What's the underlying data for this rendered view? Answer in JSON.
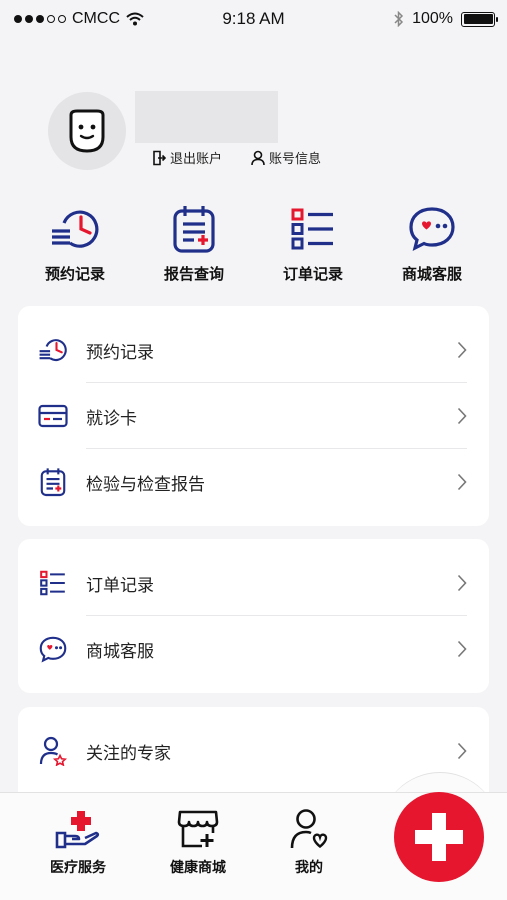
{
  "status_bar": {
    "carrier": "CMCC",
    "time": "9:18 AM",
    "battery": "100%"
  },
  "profile": {
    "logout_label": "退出账户",
    "account_info_label": "账号信息"
  },
  "quick_actions": [
    {
      "label": "预约记录",
      "icon": "appointment-history-icon"
    },
    {
      "label": "报告查询",
      "icon": "report-clipboard-icon"
    },
    {
      "label": "订单记录",
      "icon": "order-list-icon"
    },
    {
      "label": "商城客服",
      "icon": "chat-heart-icon"
    }
  ],
  "card1": {
    "rows": [
      {
        "label": "预约记录",
        "icon": "appointment-history-icon"
      },
      {
        "label": "就诊卡",
        "icon": "medical-card-icon"
      },
      {
        "label": "检验与检查报告",
        "icon": "report-clipboard-icon"
      }
    ]
  },
  "card2": {
    "rows": [
      {
        "label": "订单记录",
        "icon": "order-list-icon"
      },
      {
        "label": "商城客服",
        "icon": "chat-heart-icon"
      }
    ]
  },
  "card3": {
    "rows": [
      {
        "label": "关注的专家",
        "icon": "expert-user-icon"
      }
    ]
  },
  "tabbar": {
    "tabs": [
      {
        "label": "医疗服务",
        "icon": "medical-hand-cross-icon"
      },
      {
        "label": "健康商城",
        "icon": "health-store-icon"
      },
      {
        "label": "我的",
        "icon": "user-heart-icon"
      }
    ],
    "fab_icon": "red-cross-icon"
  },
  "colors": {
    "primary_blue": "#1f2f8a",
    "accent_red": "#e5162e",
    "background": "#f4f4f6"
  }
}
